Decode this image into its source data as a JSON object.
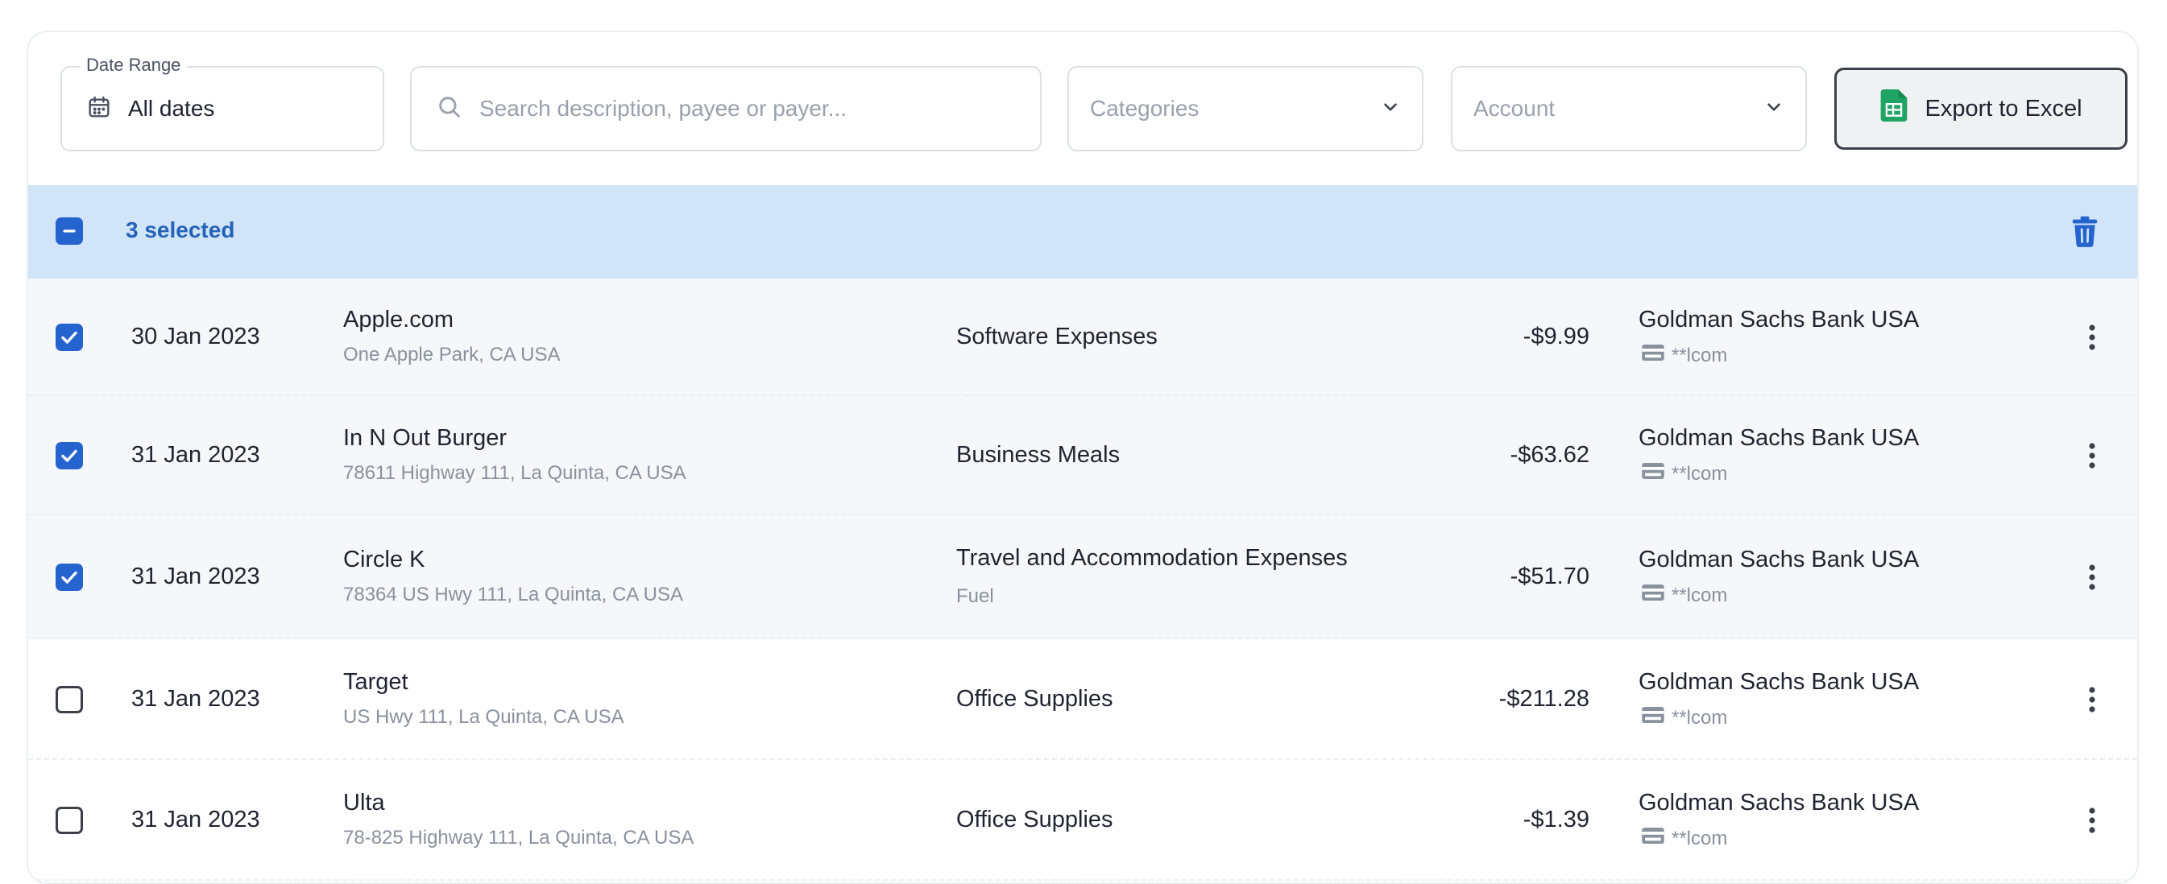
{
  "filters": {
    "date_range_label": "Date Range",
    "date_range_value": "All dates",
    "search_placeholder": "Search description, payee or payer...",
    "categories_placeholder": "Categories",
    "account_placeholder": "Account",
    "export_label": "Export to Excel"
  },
  "selection": {
    "count_label": "3 selected"
  },
  "colors": {
    "accent": "#2563cf",
    "selection_bar": "#d2e5f8",
    "sheets_green": "#1fa463"
  },
  "transactions": [
    {
      "selected": true,
      "date": "30 Jan 2023",
      "payee": "Apple.com",
      "address": "One Apple Park, CA USA",
      "category": "Software Expenses",
      "subcategory": "",
      "amount": "-$9.99",
      "bank": "Goldman Sachs Bank USA",
      "account": "**lcom"
    },
    {
      "selected": true,
      "date": "31 Jan 2023",
      "payee": "In N Out Burger",
      "address": "78611 Highway 111, La Quinta, CA USA",
      "category": "Business Meals",
      "subcategory": "",
      "amount": "-$63.62",
      "bank": "Goldman Sachs Bank USA",
      "account": "**lcom"
    },
    {
      "selected": true,
      "date": "31 Jan 2023",
      "payee": "Circle K",
      "address": "78364 US Hwy 111, La Quinta, CA USA",
      "category": "Travel and Accommodation Expenses",
      "subcategory": "Fuel",
      "amount": "-$51.70",
      "bank": "Goldman Sachs Bank USA",
      "account": "**lcom"
    },
    {
      "selected": false,
      "date": "31 Jan 2023",
      "payee": "Target",
      "address": "US Hwy 111, La Quinta, CA USA",
      "category": "Office Supplies",
      "subcategory": "",
      "amount": "-$211.28",
      "bank": "Goldman Sachs Bank USA",
      "account": "**lcom"
    },
    {
      "selected": false,
      "date": "31 Jan 2023",
      "payee": "Ulta",
      "address": "78-825 Highway 111, La Quinta, CA USA",
      "category": "Office Supplies",
      "subcategory": "",
      "amount": "-$1.39",
      "bank": "Goldman Sachs Bank USA",
      "account": "**lcom"
    }
  ]
}
